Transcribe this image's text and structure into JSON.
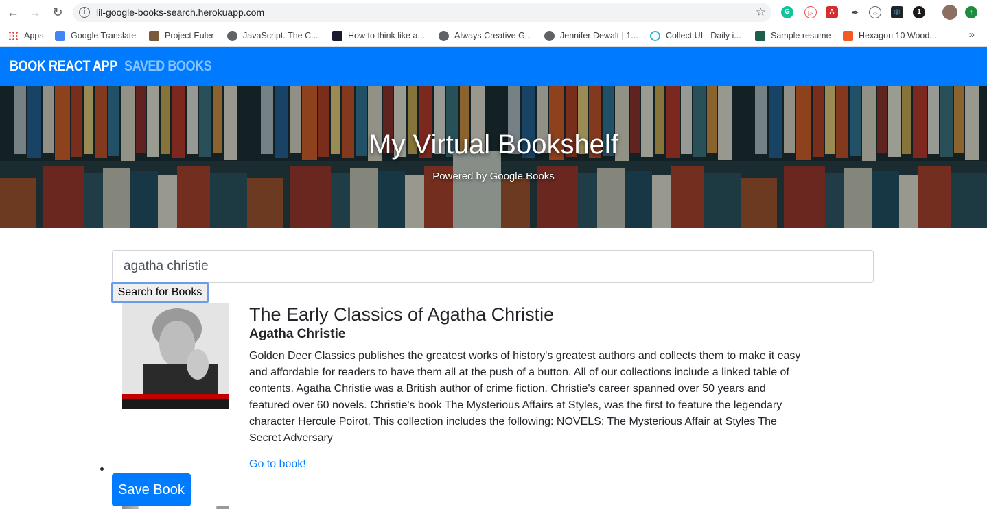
{
  "browser": {
    "url": "lil-google-books-search.herokuapp.com",
    "bookmarks": [
      {
        "label": "Apps"
      },
      {
        "label": "Google Translate"
      },
      {
        "label": "Project Euler"
      },
      {
        "label": "JavaScript. The C..."
      },
      {
        "label": "How to think like a..."
      },
      {
        "label": "Always Creative G..."
      },
      {
        "label": "Jennifer Dewalt | 1..."
      },
      {
        "label": "Collect UI - Daily i..."
      },
      {
        "label": "Sample resume"
      },
      {
        "label": "Hexagon 10 Wood..."
      }
    ],
    "more_glyph": "»"
  },
  "navbar": {
    "brand": "BOOK REACT APP",
    "saved_link": "SAVED BOOKS"
  },
  "hero": {
    "title": "My Virtual Bookshelf",
    "subtitle": "Powered by Google Books"
  },
  "search": {
    "value": "agatha christie",
    "button_label": "Search for Books"
  },
  "results": [
    {
      "title": "The Early Classics of Agatha Christie",
      "author": "Agatha Christie",
      "description": "Golden Deer Classics publishes the greatest works of history's greatest authors and collects them to make it easy and affordable for readers to have them all at the push of a button. All of our collections include a linked table of contents. Agatha Christie was a British author of crime fiction. Christie's career spanned over 50 years and featured over 60 novels. Christie's book The Mysterious Affairs at Styles, was the first to feature the legendary character Hercule Poirot. This collection includes the following: NOVELS: The Mysterious Affair at Styles The Secret Adversary",
      "link_label": "Go to book!",
      "save_label": "Save Book"
    }
  ]
}
